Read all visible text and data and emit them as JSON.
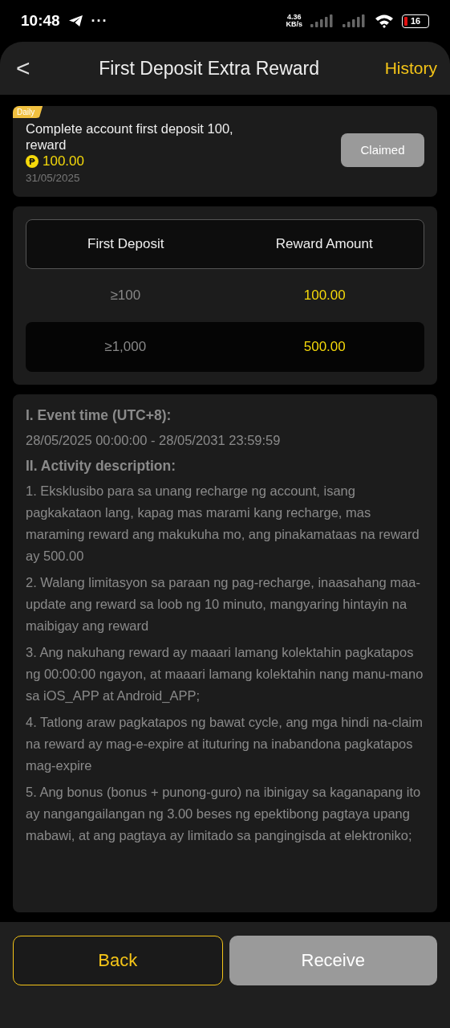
{
  "status_bar": {
    "time": "10:48",
    "more": "···",
    "speed_value": "4.36",
    "speed_unit": "KB/s",
    "battery": "16"
  },
  "header": {
    "back": "<",
    "title": "First Deposit Extra Reward",
    "action": "History"
  },
  "task": {
    "tag": "Daily",
    "text": "Complete account first deposit 100, reward",
    "currency": "₱",
    "amount": "100.00",
    "date": "31/05/2025",
    "button": {
      "label": "Claimed",
      "disabled": true
    }
  },
  "table": {
    "columns": [
      "First Deposit",
      "Reward Amount"
    ],
    "rows": [
      {
        "deposit": "≥100",
        "reward": "100.00"
      },
      {
        "deposit": "≥1,000",
        "reward": "500.00"
      }
    ]
  },
  "rules": [
    {
      "kind": "heading",
      "text": "I. Event time (UTC+8):"
    },
    {
      "kind": "paragraph",
      "text": "28/05/2025 00:00:00 - 28/05/2031 23:59:59"
    },
    {
      "kind": "heading",
      "text": "II. Activity description:"
    },
    {
      "kind": "paragraph",
      "text": "1. Eksklusibo para sa unang recharge ng account, isang pagkakataon lang, kapag mas marami kang recharge, mas maraming reward ang makukuha mo, ang pinakamataas na reward ay 500.00"
    },
    {
      "kind": "paragraph",
      "text": "2. Walang limitasyon sa paraan ng pag-recharge, inaasahang maa-update ang reward sa loob ng 10 minuto, mangyaring hintayin na maibigay ang reward"
    },
    {
      "kind": "paragraph",
      "text": "3. Ang nakuhang reward ay maaari lamang kolektahin pagkatapos ng 00:00:00 ngayon, at maaari lamang kolektahin nang manu-mano sa iOS_APP at Android_APP;"
    },
    {
      "kind": "paragraph",
      "text": "4. Tatlong araw pagkatapos ng bawat cycle, ang mga hindi na-claim na reward ay mag-e-expire at ituturing na inabandona pagkatapos mag-expire"
    },
    {
      "kind": "paragraph",
      "text": "5. Ang bonus (bonus + punong-guro) na ibinigay sa kaganapang ito ay nangangailangan ng 3.00 beses ng epektibong pagtaya upang mabawi, at ang pagtaya ay limitado sa pangingisda at elektroniko;"
    }
  ],
  "footer": [
    {
      "kind": "outline",
      "label": "Back",
      "disabled": false
    },
    {
      "kind": "solid",
      "label": "Receive",
      "disabled": true
    }
  ]
}
